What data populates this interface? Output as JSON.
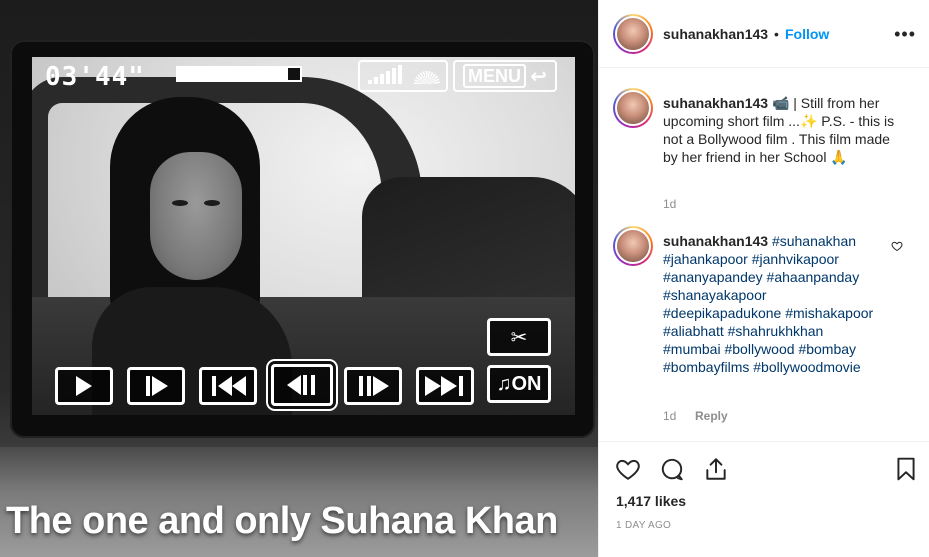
{
  "post": {
    "username": "suhanakhan143",
    "follow_label": "Follow",
    "more_label": "•••"
  },
  "media": {
    "hud_time": "03'44\"",
    "hud_progress": 0.9,
    "menu_label": "MENU",
    "music_label": "♫ON",
    "caption": "The one and only Suhana Khan"
  },
  "caption_comment": {
    "username": "suhanakhan143",
    "text": "📹 | Still from her upcoming short film ...✨ P.S. - this is not a Bollywood film . This film made by her friend in her School 🙏",
    "time": "1d"
  },
  "hashtag_comment": {
    "username": "suhanakhan143",
    "tags": [
      "#suhanakhan",
      "#jahankapoor",
      "#janhvikapoor",
      "#ananyapandey",
      "#ahaanpanday",
      "#shanayakapoor",
      "#deepikapadukone",
      "#mishakapoor",
      "#aliabhatt",
      "#shahrukhkhan",
      "#mumbai",
      "#bollywood",
      "#bombay",
      "#bombayfilms",
      "#bollywoodmovie"
    ],
    "time": "1d",
    "reply_label": "Reply"
  },
  "footer": {
    "likes": "1,417 likes",
    "posted": "1 DAY AGO"
  },
  "icons": {
    "heart": "heart-icon",
    "comment": "comment-icon",
    "share": "share-icon",
    "save": "bookmark-icon"
  }
}
